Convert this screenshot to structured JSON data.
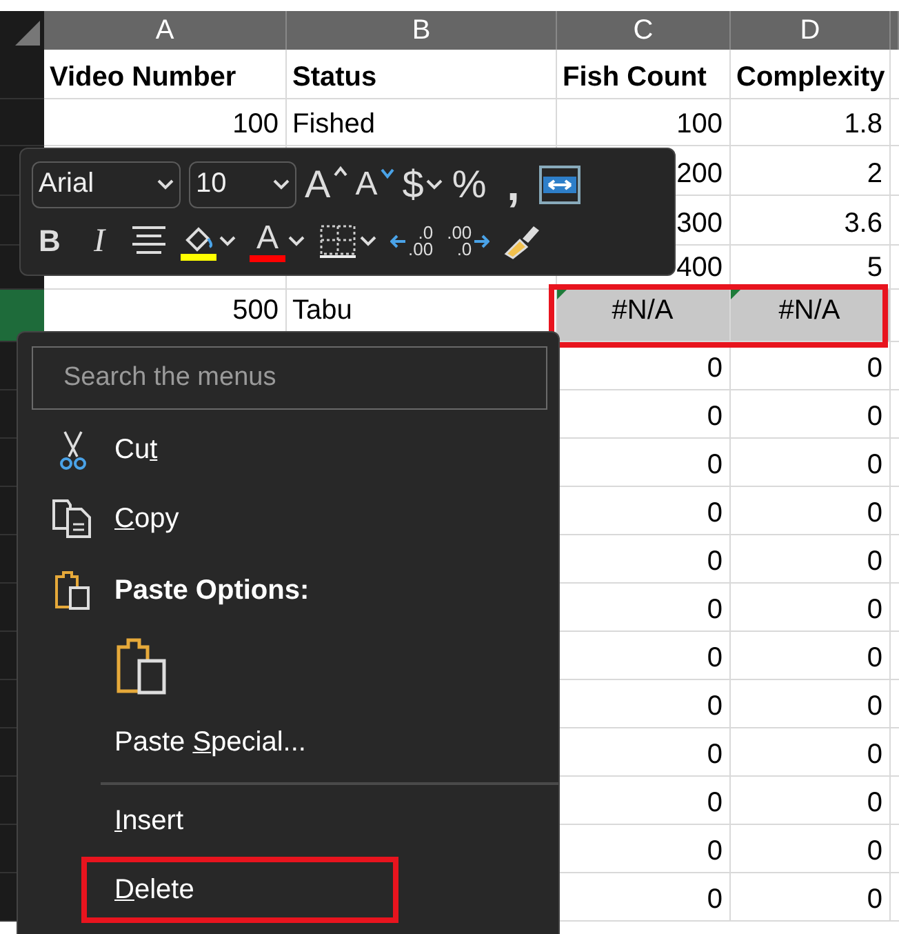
{
  "columns": [
    {
      "label": "A"
    },
    {
      "label": "B"
    },
    {
      "label": "C"
    },
    {
      "label": "D"
    }
  ],
  "rows": [
    {
      "kind": "header",
      "a": "Video Number",
      "b": "Status",
      "c": "Fish Count",
      "d": "Complexity"
    },
    {
      "kind": "data",
      "a": "100",
      "b": "Fished",
      "c": "100",
      "d": "1.8"
    },
    {
      "kind": "data",
      "c": "200",
      "d": "2"
    },
    {
      "kind": "data",
      "c": "300",
      "d": "3.6"
    },
    {
      "kind": "data",
      "c": "400",
      "d": "5"
    },
    {
      "kind": "data",
      "selected": true,
      "highlighted": true,
      "error": true,
      "a": "500",
      "b": "Tabu",
      "c": "#N/A",
      "d": "#N/A"
    },
    {
      "kind": "data",
      "c": "0",
      "d": "0"
    },
    {
      "kind": "data",
      "c": "0",
      "d": "0"
    },
    {
      "kind": "data",
      "c": "0",
      "d": "0"
    },
    {
      "kind": "data",
      "c": "0",
      "d": "0"
    },
    {
      "kind": "data",
      "c": "0",
      "d": "0"
    },
    {
      "kind": "data",
      "c": "0",
      "d": "0"
    },
    {
      "kind": "data",
      "c": "0",
      "d": "0"
    },
    {
      "kind": "data",
      "c": "0",
      "d": "0"
    },
    {
      "kind": "data",
      "c": "0",
      "d": "0"
    },
    {
      "kind": "data",
      "c": "0",
      "d": "0"
    },
    {
      "kind": "data",
      "c": "0",
      "d": "0"
    },
    {
      "kind": "data",
      "c": "0",
      "d": "0"
    }
  ],
  "mini_toolbar": {
    "font": "Arial",
    "size": "10",
    "row_1": [
      {
        "kind": "grow-font",
        "label": "A"
      },
      {
        "kind": "shrink-font",
        "label": "A"
      },
      {
        "kind": "currency",
        "label": "$",
        "dropdown": true
      },
      {
        "kind": "percent",
        "label": "%"
      },
      {
        "kind": "comma",
        "label": ","
      },
      {
        "kind": "wrap"
      }
    ],
    "row_2": [
      {
        "kind": "bold",
        "label": "B"
      },
      {
        "kind": "italic",
        "label": "I"
      },
      {
        "kind": "align"
      },
      {
        "kind": "fill-color",
        "color": "#ffff00",
        "dropdown": true
      },
      {
        "kind": "font-color",
        "label": "A",
        "color": "#ff0000",
        "dropdown": true
      },
      {
        "kind": "borders",
        "dropdown": true
      },
      {
        "kind": "increase-decimal",
        "top": ".0",
        "bottom": ".00"
      },
      {
        "kind": "decrease-decimal",
        "top": ".00",
        "bottom": ".0"
      },
      {
        "kind": "format-painter"
      }
    ]
  },
  "context_menu": {
    "search": {
      "placeholder": "Search the menus"
    },
    "items": [
      {
        "kind": "cut",
        "pre": "Cu",
        "key": "t",
        "highlighted": false
      },
      {
        "kind": "copy",
        "key": "C",
        "post": "opy",
        "highlighted": false
      },
      {
        "kind": "heading",
        "label": "Paste Options:"
      },
      {
        "kind": "paste-choice"
      },
      {
        "kind": "command",
        "pre": "Paste ",
        "key": "S",
        "post": "pecial...",
        "highlighted": false
      },
      {
        "kind": "separator"
      },
      {
        "kind": "command",
        "key": "I",
        "post": "nsert",
        "highlighted": false
      },
      {
        "kind": "command",
        "key": "D",
        "post": "elete",
        "highlighted": true
      }
    ]
  }
}
